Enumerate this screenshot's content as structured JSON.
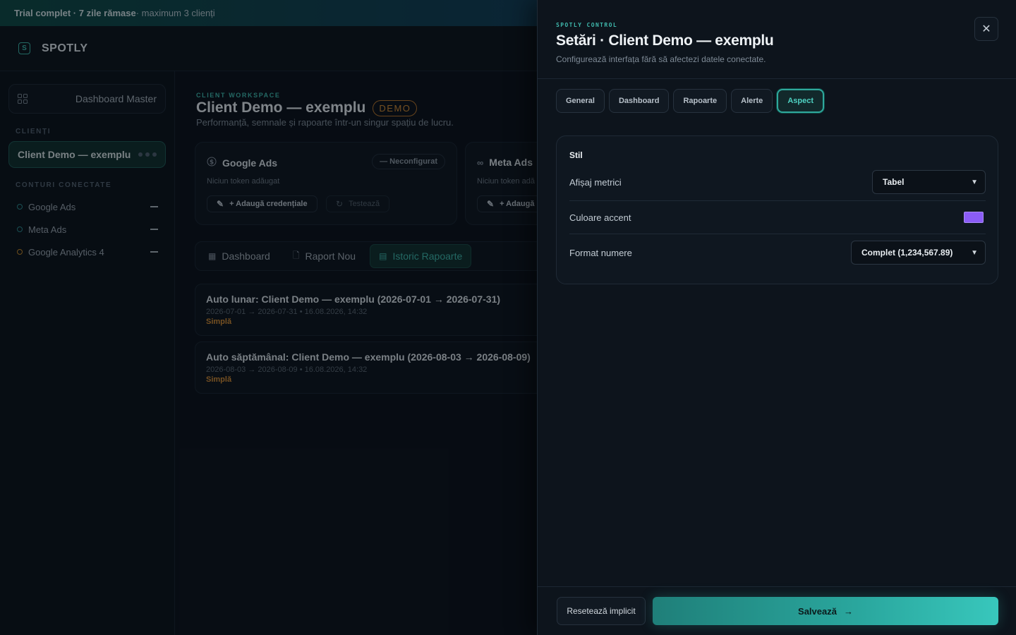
{
  "banner": {
    "bold": "Trial complet · 7 zile rămase",
    "rest": " · maximum 3 clienți"
  },
  "brand": {
    "mark": "S",
    "name": "SPOTLY"
  },
  "sidebar": {
    "dashboard_master": "Dashboard Master",
    "clients_label": "CLIENȚI",
    "active_client": "Client Demo — exemplu",
    "accounts_label": "CONTURI CONECTATE",
    "accounts": [
      {
        "name": "Google Ads"
      },
      {
        "name": "Meta Ads"
      },
      {
        "name": "Google Analytics 4"
      }
    ]
  },
  "workspace": {
    "kicker": "CLIENT WORKSPACE",
    "title": "Client Demo — exemplu",
    "badge": "DEMO",
    "subtitle": "Performanță, semnale și rapoarte într-un singur spațiu de lucru."
  },
  "cards": [
    {
      "name": "Google Ads",
      "status": "— Neconfigurat",
      "empty": "Niciun token adăugat",
      "add": "+ Adaugă credențiale",
      "test": "Testează"
    },
    {
      "name": "Meta Ads",
      "empty": "Niciun token adă",
      "add": "+ Adaugă"
    }
  ],
  "main_tabs": [
    {
      "label": "Dashboard"
    },
    {
      "label": "Raport Nou"
    },
    {
      "label": "Istoric Rapoarte"
    }
  ],
  "reports": [
    {
      "title": "Auto lunar: Client Demo — exemplu (2026-07-01 → 2026-07-31)",
      "meta": "2026-07-01 → 2026-07-31 • 16.08.2026, 14:32",
      "kind": "Simplă"
    },
    {
      "title": "Auto săptămânal: Client Demo — exemplu (2026-08-03 → 2026-08-09)",
      "meta": "2026-08-03 → 2026-08-09 • 16.08.2026, 14:32",
      "kind": "Simplă"
    }
  ],
  "drawer": {
    "kicker": "SPOTLY CONTROL",
    "title": "Setări · Client Demo — exemplu",
    "subtitle": "Configurează interfața fără să afectezi datele conectate.",
    "close": "✕",
    "tabs": [
      {
        "label": "General"
      },
      {
        "label": "Dashboard"
      },
      {
        "label": "Rapoarte"
      },
      {
        "label": "Alerte"
      },
      {
        "label": "Aspect"
      }
    ],
    "active_tab": "Aspect",
    "style_section": {
      "title": "Stil",
      "metrics_display_label": "Afișaj metrici",
      "metrics_display_value": "Tabel",
      "accent_color_label": "Culoare accent",
      "accent_color": "#8b5cf6",
      "number_format_label": "Format numere",
      "number_format_value": "Complet (1,234,567.89)"
    },
    "reset_label": "Resetează implicit",
    "save_label": "Salvează",
    "save_arrow": "→"
  },
  "colors": {
    "accent": "#3fb8ac",
    "badge": "#d38c35"
  },
  "icons": {
    "dashboard": "grid-icon",
    "google_ads": "dollar-circle-icon",
    "meta_ads": "infinity-icon",
    "edit": "pencil-icon",
    "test": "refresh-icon",
    "new_report": "document-plus-icon",
    "history": "archive-icon",
    "select": "chevron-down-icon",
    "close": "close-icon"
  }
}
